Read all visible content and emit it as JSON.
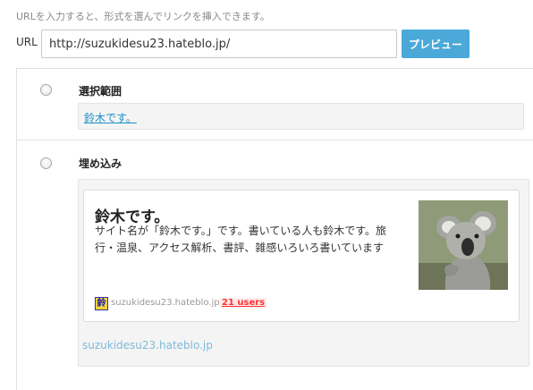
{
  "header": {
    "hint": "URLを入力すると、形式を選んでリンクを挿入できます。",
    "url_label": "URL",
    "url_value": "http://suzukidesu23.hateblo.jp/",
    "preview_label": "プレビュー"
  },
  "options": {
    "selection": {
      "title": "選択範囲",
      "link_text": "鈴木です。"
    },
    "embed": {
      "title": "埋め込み",
      "card_title": "鈴木です。",
      "card_description": "サイト名が「鈴木です。」です。書いている人も鈴木です。旅行・温泉、アクセス解析、書評、雑感いろいろ書いています",
      "favicon_char": "鈴",
      "domain": "suzukidesu23.hateblo.jp",
      "users": "21 users",
      "footer_link": "suzukidesu23.hateblo.jp"
    }
  },
  "colors": {
    "accent": "#4aa9d8",
    "link": "#1a8fc8",
    "users": "#ff3333"
  },
  "icons": {
    "radio_selection": "radio-button-icon",
    "radio_embed": "radio-button-icon",
    "thumbnail": "koala-thumbnail-image",
    "favicon": "site-favicon-icon"
  }
}
